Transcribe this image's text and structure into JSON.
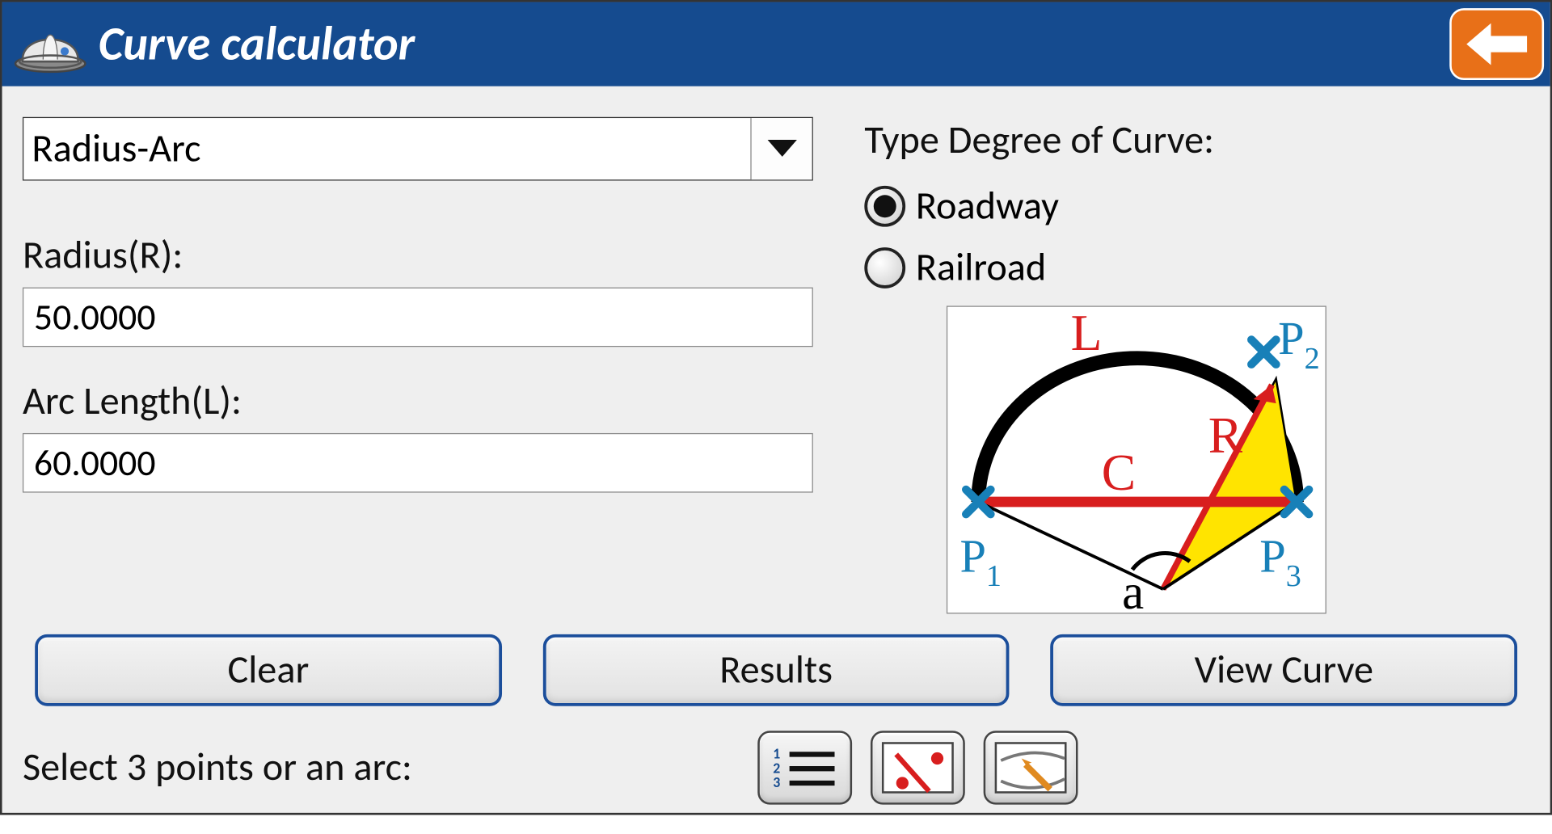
{
  "header": {
    "title": "Curve calculator",
    "logo_name": "hardhat-icon",
    "back_name": "back-arrow-icon"
  },
  "dropdown": {
    "selected": "Radius-Arc"
  },
  "fields": {
    "radius_label": "Radius(R):",
    "radius_value": "50.0000",
    "arc_label": "Arc Length(L):",
    "arc_value": "60.0000"
  },
  "type_degree": {
    "label": "Type Degree of Curve:",
    "options": {
      "roadway": "Roadway",
      "railroad": "Railroad"
    },
    "selected": "roadway"
  },
  "diagram": {
    "labels": {
      "L": "L",
      "P2": "P",
      "P2sub": "2",
      "C": "C",
      "R": "R",
      "P1": "P",
      "P1sub": "1",
      "a": "a",
      "P3": "P",
      "P3sub": "3"
    }
  },
  "buttons": {
    "clear": "Clear",
    "results": "Results",
    "view": "View Curve"
  },
  "footer": {
    "select_label": "Select 3 points or an arc:",
    "tools": {
      "list": "list-icon",
      "points": "points-icon",
      "map": "map-pick-icon"
    }
  }
}
